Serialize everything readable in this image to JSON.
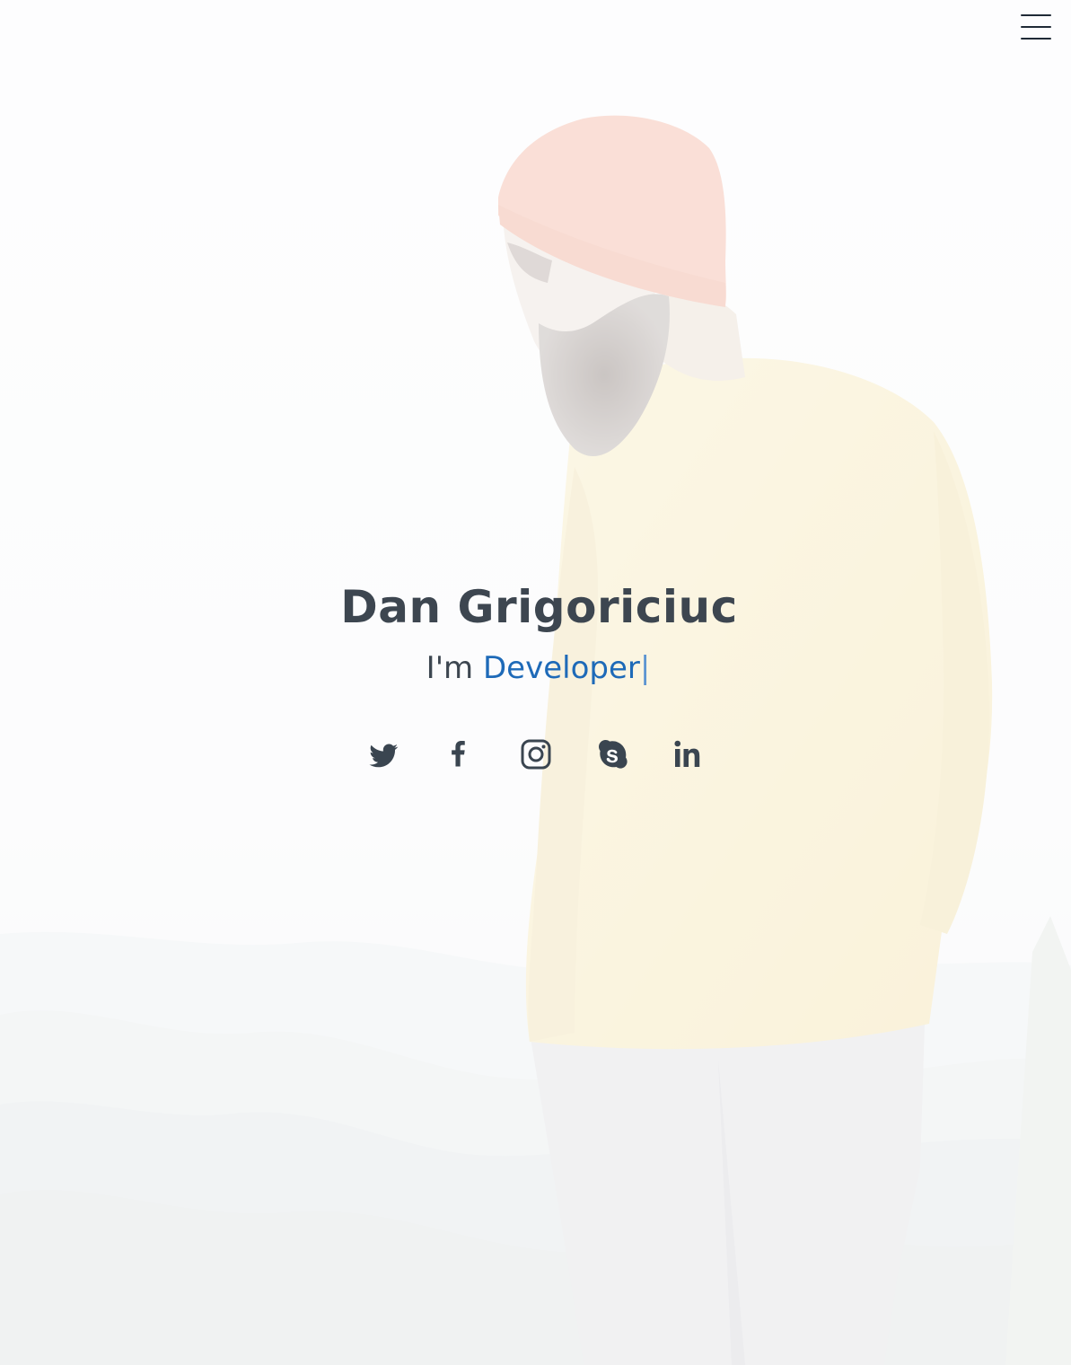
{
  "hero": {
    "name": "Dan Grigoriciuc",
    "tagline_prefix": "I'm ",
    "tagline_typed": "Developer",
    "tagline_cursor": "|"
  },
  "header": {
    "menu_icon": "hamburger-menu-icon"
  },
  "social": [
    {
      "icon": "twitter-icon"
    },
    {
      "icon": "facebook-icon"
    },
    {
      "icon": "instagram-icon"
    },
    {
      "icon": "skype-icon"
    },
    {
      "icon": "linkedin-icon"
    }
  ],
  "colors": {
    "text": "#3d4650",
    "accent": "#1e6ab8",
    "cursor": "#5d95d1",
    "icon": "#3a4550"
  }
}
